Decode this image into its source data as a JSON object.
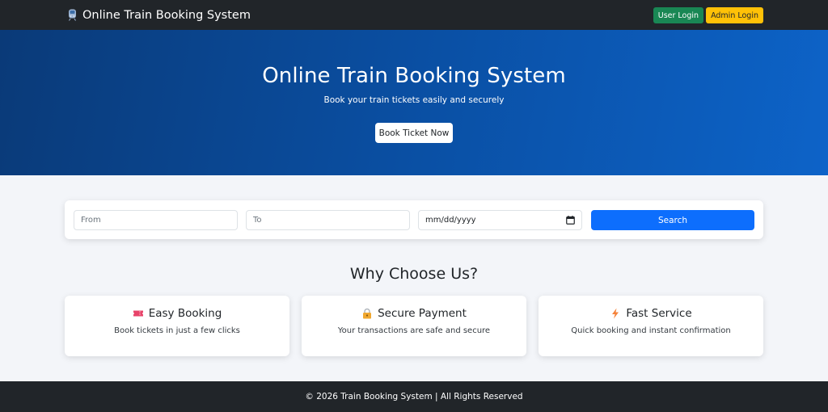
{
  "navbar": {
    "brand": "Online Train Booking System",
    "brand_icon": "train-icon",
    "user_login_label": "User Login",
    "admin_login_label": "Admin Login"
  },
  "hero": {
    "title": "Online Train Booking System",
    "subtitle": "Book your train tickets easily and securely",
    "button_label": "Book Ticket Now"
  },
  "search": {
    "from_placeholder": "From",
    "to_placeholder": "To",
    "date_placeholder": "mm/dd/yyyy",
    "button_label": "Search"
  },
  "features": {
    "title": "Why Choose Us?",
    "items": [
      {
        "icon": "ticket-icon",
        "title": "Easy Booking",
        "description": "Book tickets in just a few clicks"
      },
      {
        "icon": "lock-icon",
        "title": "Secure Payment",
        "description": "Your transactions are safe and secure"
      },
      {
        "icon": "lightning-icon",
        "title": "Fast Service",
        "description": "Quick booking and instant confirmation"
      }
    ]
  },
  "footer": {
    "text": "© 2026 Train Booking System | All Rights Reserved"
  },
  "colors": {
    "navbar_bg": "#212529",
    "user_login": "#198754",
    "admin_login": "#ffc107",
    "hero_start": "#0a3a78",
    "hero_end": "#0d63c8",
    "primary": "#0d6efd",
    "page_bg": "#f3f5f9"
  }
}
